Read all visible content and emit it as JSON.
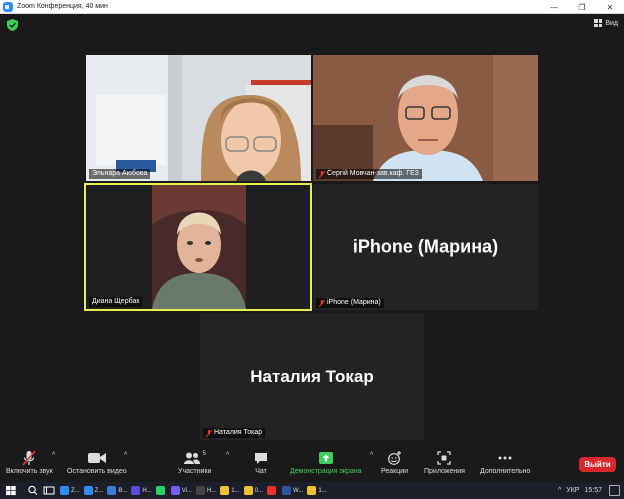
{
  "window": {
    "title": "Zoom Конференция, 40 мин",
    "minimize": "—",
    "maximize": "❐",
    "close": "✕"
  },
  "header": {
    "view_label": "Вид"
  },
  "participants": [
    {
      "name": "Эльнара Аюбова",
      "muted": false
    },
    {
      "name": "Сергій Мовчан-зав.каф. ГЕЗ",
      "muted": true
    },
    {
      "name": "Диана Щербак",
      "muted": false,
      "active_speaker": true
    },
    {
      "name": "iPhone (Марина)",
      "muted": true,
      "display_label": "iPhone (Марина)"
    },
    {
      "name": "Наталия Токар",
      "muted": true,
      "display_label": "Наталия Токар"
    }
  ],
  "toolbar": {
    "unmute_label": "Включить звук",
    "stop_video_label": "Остановить видео",
    "participants_label": "Участники",
    "participants_count": "5",
    "chat_label": "Чат",
    "share_label": "Демонстрация экрана",
    "reactions_label": "Реакции",
    "apps_label": "Приложения",
    "more_label": "Дополнительно",
    "leave_label": "Выйти",
    "caret": "^"
  },
  "taskbar": {
    "apps": [
      {
        "label": "Z...",
        "color": "#2d8cff"
      },
      {
        "label": "Z...",
        "color": "#2d8cff"
      },
      {
        "label": "B...",
        "color": "#3b7bd8"
      },
      {
        "label": "H...",
        "color": "#5a4bd6"
      },
      {
        "label": "",
        "color": "#25d366"
      },
      {
        "label": "Vi...",
        "color": "#7360f2"
      },
      {
        "label": "H...",
        "color": "#444"
      },
      {
        "label": "1...",
        "color": "#f2c12e"
      },
      {
        "label": "0...",
        "color": "#f2c12e"
      },
      {
        "label": "",
        "color": "#ee3124"
      },
      {
        "label": "W...",
        "color": "#2b579a"
      },
      {
        "label": "1...",
        "color": "#f2c12e"
      }
    ],
    "language": "УКР",
    "time": "15:57"
  },
  "colors": {
    "active_border": "#e8f050",
    "leave_button": "#d8282c",
    "share_green": "#3fce5d",
    "shield_green": "#3fce5d"
  }
}
